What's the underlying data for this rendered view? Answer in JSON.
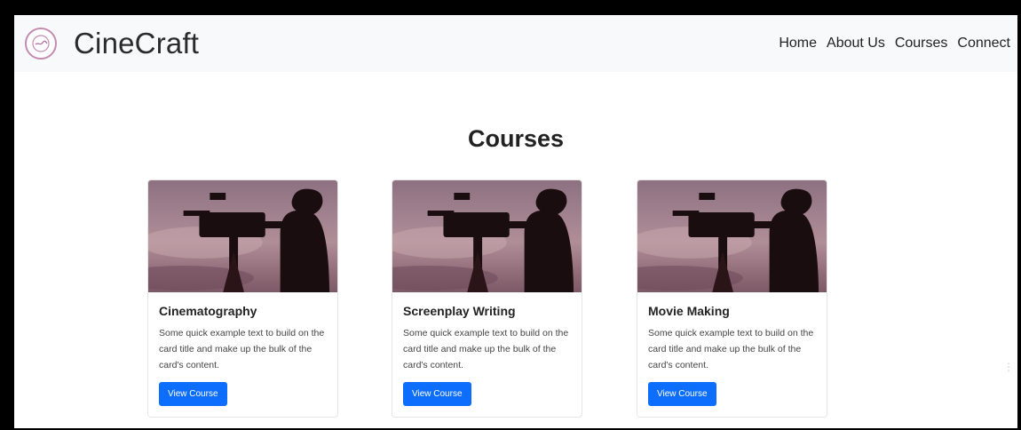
{
  "brand": "CineCraft",
  "nav": {
    "home": "Home",
    "about": "About Us",
    "courses": "Courses",
    "connect": "Connect"
  },
  "page_title": "Courses",
  "cards": [
    {
      "title": "Cinematography",
      "text": "Some quick example text to build on the card title and make up the bulk of the card's content.",
      "button": "View Course"
    },
    {
      "title": "Screenplay Writing",
      "text": "Some quick example text to build on the card title and make up the bulk of the card's content.",
      "button": "View Course"
    },
    {
      "title": "Movie Making",
      "text": "Some quick example text to build on the card title and make up the bulk of the card's content.",
      "button": "View Course"
    }
  ],
  "colors": {
    "accent": "#0d6efd",
    "navbar_bg": "#f7f9fb",
    "logo_ring": "#c58ab0"
  }
}
